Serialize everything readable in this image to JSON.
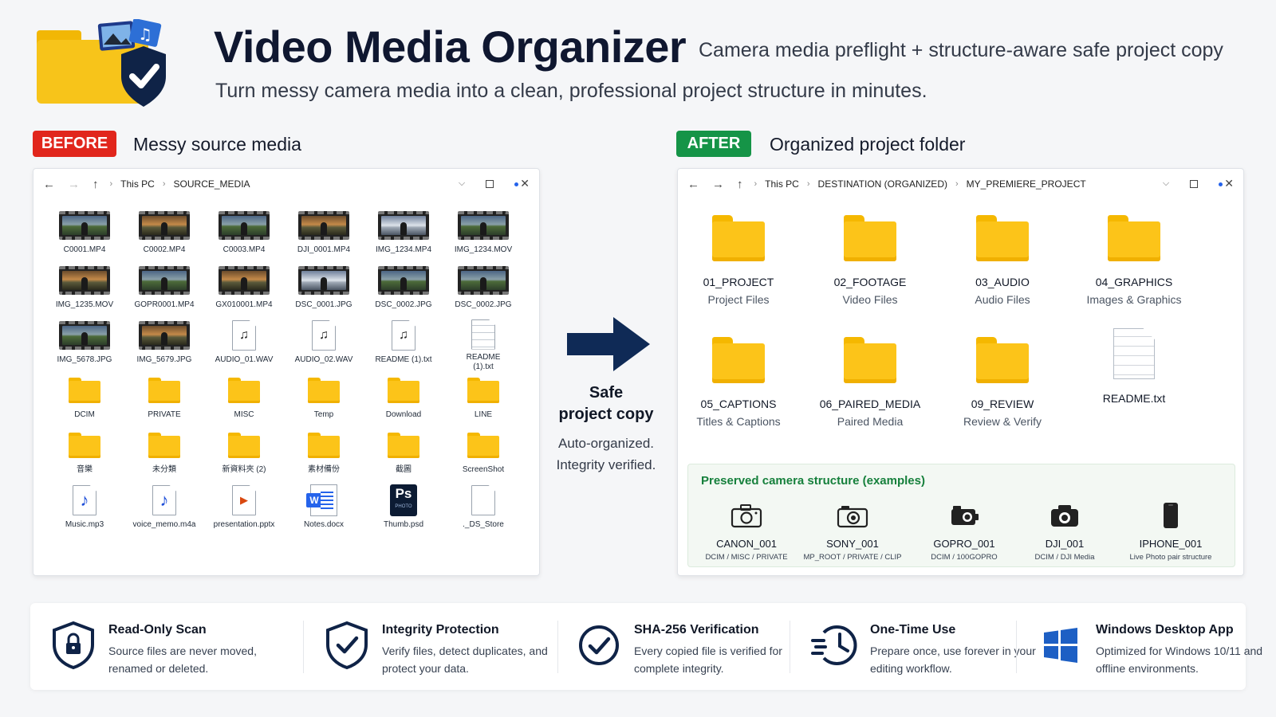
{
  "header": {
    "title": "Video Media Organizer",
    "subtitle": "Camera media preflight + structure-aware safe project copy",
    "tagline": "Turn messy camera media into a clean, professional project structure in minutes."
  },
  "before": {
    "badge": "BEFORE",
    "label": "Messy source media",
    "breadcrumb": [
      "This PC",
      "SOURCE_MEDIA"
    ],
    "rows": [
      [
        {
          "name": "C0001.MP4",
          "icon": "video"
        },
        {
          "name": "C0002.MP4",
          "icon": "video"
        },
        {
          "name": "C0003.MP4",
          "icon": "video"
        },
        {
          "name": "DJI_0001.MP4",
          "icon": "video"
        },
        {
          "name": "IMG_1234.MP4",
          "icon": "video"
        },
        {
          "name": "IMG_1234.MOV",
          "icon": "video"
        }
      ],
      [
        {
          "name": "IMG_1235.MOV",
          "icon": "video"
        },
        {
          "name": "GOPR0001.MP4",
          "icon": "video"
        },
        {
          "name": "GX010001.MP4",
          "icon": "video"
        },
        {
          "name": "DSC_0001.JPG",
          "icon": "video"
        },
        {
          "name": "DSC_0002.JPG",
          "icon": "video"
        },
        {
          "name": "DSC_0002.JPG",
          "icon": "video"
        }
      ],
      [
        {
          "name": "IMG_5678.JPG",
          "icon": "video"
        },
        {
          "name": "IMG_5679.JPG",
          "icon": "video"
        },
        {
          "name": "AUDIO_01.WAV",
          "icon": "audio"
        },
        {
          "name": "AUDIO_02.WAV",
          "icon": "audio"
        },
        {
          "name": "README (1).txt",
          "icon": "audio"
        },
        {
          "name": "README (1).txt",
          "icon": "text"
        }
      ],
      [
        {
          "name": "DCIM",
          "icon": "folder"
        },
        {
          "name": "PRIVATE",
          "icon": "folder"
        },
        {
          "name": "MISC",
          "icon": "folder"
        },
        {
          "name": "Temp",
          "icon": "folder"
        },
        {
          "name": "Download",
          "icon": "folder"
        },
        {
          "name": "LINE",
          "icon": "folder"
        }
      ],
      [
        {
          "name": "音樂",
          "icon": "folder"
        },
        {
          "name": "未分類",
          "icon": "folder"
        },
        {
          "name": "新資料夾 (2)",
          "icon": "folder"
        },
        {
          "name": "素材備份",
          "icon": "folder"
        },
        {
          "name": "截圖",
          "icon": "folder"
        },
        {
          "name": "ScreenShot",
          "icon": "folder"
        }
      ],
      [
        {
          "name": "Music.mp3",
          "icon": "music"
        },
        {
          "name": "voice_memo.m4a",
          "icon": "music"
        },
        {
          "name": "presentation.pptx",
          "icon": "ppt"
        },
        {
          "name": "Notes.docx",
          "icon": "word"
        },
        {
          "name": "Thumb.psd",
          "icon": "ps"
        },
        {
          "name": "._DS_Store",
          "icon": "blank"
        }
      ]
    ]
  },
  "center": {
    "title_line1": "Safe",
    "title_line2": "project copy",
    "sub_line1": "Auto-organized.",
    "sub_line2": "Integrity verified."
  },
  "after": {
    "badge": "AFTER",
    "label": "Organized project folder",
    "breadcrumb": [
      "This PC",
      "DESTINATION (ORGANIZED)",
      "MY_PREMIERE_PROJECT"
    ],
    "folders": [
      {
        "name": "01_PROJECT",
        "desc": "Project Files"
      },
      {
        "name": "02_FOOTAGE",
        "desc": "Video Files"
      },
      {
        "name": "03_AUDIO",
        "desc": "Audio Files"
      },
      {
        "name": "04_GRAPHICS",
        "desc": "Images & Graphics"
      },
      {
        "name": "05_CAPTIONS",
        "desc": "Titles & Captions"
      },
      {
        "name": "06_PAIRED_MEDIA",
        "desc": "Paired Media"
      },
      {
        "name": "09_REVIEW",
        "desc": "Review & Verify"
      },
      {
        "name": "README.txt",
        "desc": ""
      }
    ],
    "preserved": {
      "title": "Preserved camera structure (examples)",
      "items": [
        {
          "name": "CANON_001",
          "path": "DCIM / MISC / PRIVATE",
          "icon": "camera-icon"
        },
        {
          "name": "SONY_001",
          "path": "MP_ROOT / PRIVATE / CLIP",
          "icon": "camera-icon"
        },
        {
          "name": "GOPRO_001",
          "path": "DCIM / 100GOPRO",
          "icon": "action-camera-icon"
        },
        {
          "name": "DJI_001",
          "path": "DCIM / DJI Media",
          "icon": "drone-camera-icon"
        },
        {
          "name": "IPHONE_001",
          "path": "Live Photo pair structure",
          "icon": "phone-icon"
        }
      ]
    }
  },
  "features": [
    {
      "title": "Read-Only Scan",
      "desc": "Source files are never moved, renamed or deleted.",
      "icon": "shield-lock-icon"
    },
    {
      "title": "Integrity Protection",
      "desc": "Verify files, detect duplicates, and protect your data.",
      "icon": "shield-check-icon"
    },
    {
      "title": "SHA-256 Verification",
      "desc": "Every copied file is verified for complete integrity.",
      "icon": "check-circle-icon"
    },
    {
      "title": "One-Time Use",
      "desc": "Prepare once, use forever in your editing workflow.",
      "icon": "clock-history-icon"
    },
    {
      "title": "Windows Desktop App",
      "desc": "Optimized for Windows 10/11 and offline environments.",
      "icon": "windows-logo-icon"
    }
  ],
  "colors": {
    "before_badge": "#e1261c",
    "after_badge": "#159447",
    "title": "#0f1730",
    "arrow": "#0f2a56",
    "folder": "#fcc419",
    "preserved_title": "#16803c"
  }
}
